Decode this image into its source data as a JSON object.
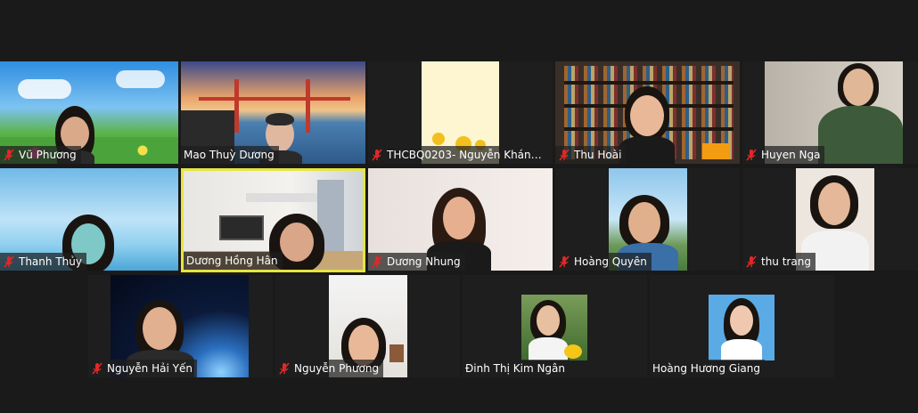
{
  "meeting": {
    "participants": [
      {
        "name": "Vũ Phương",
        "muted": true
      },
      {
        "name": "Mao Thuỳ Dương",
        "muted": false
      },
      {
        "name": "THCBQ0203- Nguyễn Khánh L...",
        "muted": true
      },
      {
        "name": "Thu Hoài",
        "muted": true
      },
      {
        "name": "Huyen Nga",
        "muted": true
      },
      {
        "name": "Thanh Thủy",
        "muted": true
      },
      {
        "name": "Dương Hồng Hân",
        "muted": false,
        "active_speaker": true
      },
      {
        "name": "Dương Nhung",
        "muted": true
      },
      {
        "name": "Hoàng Quyên",
        "muted": true
      },
      {
        "name": "thu trang",
        "muted": true
      },
      {
        "name": "Nguyễn Hải Yến",
        "muted": true
      },
      {
        "name": "Nguyễn Phương",
        "muted": true
      },
      {
        "name": "Đinh Thị Kim Ngân",
        "muted": false
      },
      {
        "name": "Hoàng Hương Giang",
        "muted": false
      }
    ]
  },
  "colors": {
    "background": "#1a1a1a",
    "tile": "#1e1e1e",
    "active_speaker_border": "#e5e542",
    "muted_mic": "#e02828",
    "name_text": "#ffffff"
  },
  "icons": {
    "muted_mic": "muted-microphone-icon"
  }
}
